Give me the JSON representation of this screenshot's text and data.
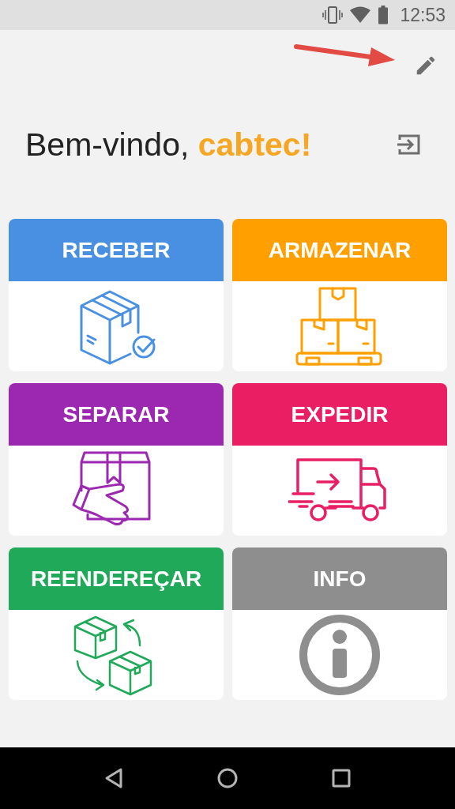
{
  "status_bar": {
    "time": "12:53"
  },
  "greeting": "Bem-vindo, **cabtec!**",
  "tiles": [
    {
      "label": "RECEBER",
      "color": "#4a90e2",
      "kind": "receive"
    },
    {
      "label": "ARMAZENAR",
      "color": "#ffa000",
      "kind": "store"
    },
    {
      "label": "SEPARAR",
      "color": "#9c27b0",
      "kind": "pick"
    },
    {
      "label": "EXPEDIR",
      "color": "#e91e63",
      "kind": "ship"
    },
    {
      "label": "REENDEREÇAR",
      "color": "#21a95a",
      "kind": "readdress"
    },
    {
      "label": "INFO",
      "color": "#8e8e8e",
      "kind": "info"
    }
  ]
}
